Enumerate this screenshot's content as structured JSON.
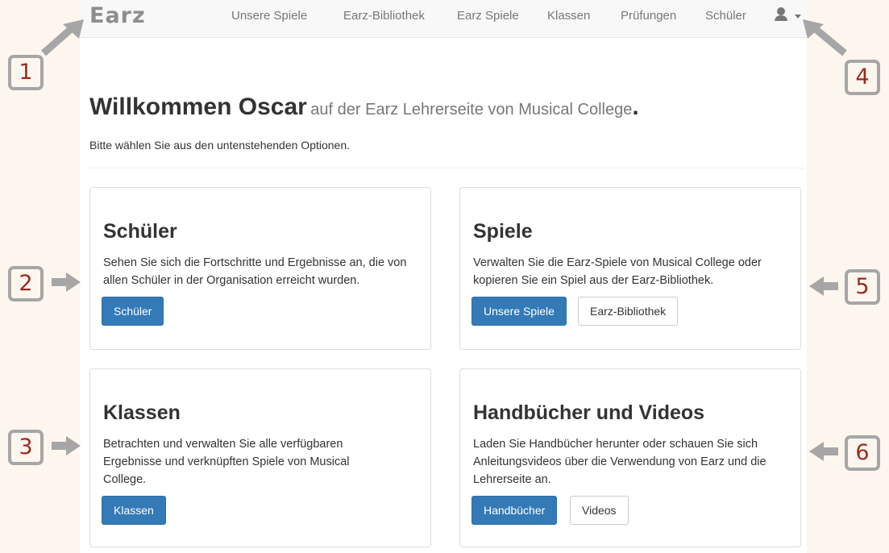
{
  "navbar": {
    "brand": "Earz",
    "items": [
      {
        "label": "Unsere Spiele"
      },
      {
        "label": "Earz-Bibliothek"
      },
      {
        "label": "Earz Spiele"
      },
      {
        "label": "Klassen"
      },
      {
        "label": "Prüfungen"
      },
      {
        "label": "Schüler"
      }
    ],
    "user_icon": "user-icon"
  },
  "header": {
    "welcome": "Willkommen Oscar",
    "subtitle": "auf der Earz Lehrerseite von Musical College",
    "period": ".",
    "instruction": "Bitte wählen Sie aus den untenstehenden Optionen."
  },
  "panels": {
    "students": {
      "title": "Schüler",
      "text": "Sehen Sie sich die Fortschritte und Ergebnisse an, die von allen Schüler in der Organisation erreicht wurden.",
      "buttons": [
        "Schüler"
      ]
    },
    "games": {
      "title": "Spiele",
      "text": "Verwalten Sie die Earz-Spiele von Musical College oder kopieren Sie ein Spiel aus der Earz-Bibliothek.",
      "buttons": [
        "Unsere Spiele",
        "Earz-Bibliothek"
      ]
    },
    "classes": {
      "title": "Klassen",
      "text": "Betrachten und verwalten Sie alle verfügbaren Ergebnisse und verknüpften Spiele von Musical College.",
      "buttons": [
        "Klassen"
      ]
    },
    "manuals": {
      "title": "Handbücher und Videos",
      "text": "Laden Sie Handbücher herunter oder schauen Sie sich Anleitungsvideos über die Verwendung von Earz und die Lehrerseite an.",
      "buttons": [
        "Handbücher",
        "Videos"
      ]
    }
  },
  "callouts": [
    "1",
    "2",
    "3",
    "4",
    "5",
    "6"
  ],
  "colors": {
    "primary": "#337ab7",
    "callout_number": "#9a2a1f",
    "callout_border": "#a6a6a6",
    "outside_background": "#fdf6ee"
  }
}
